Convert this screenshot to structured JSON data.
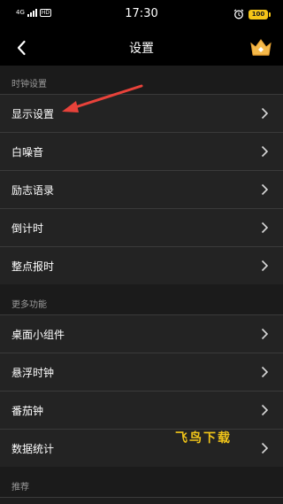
{
  "status_bar": {
    "time": "17:30",
    "network": "4G",
    "hd": "HD",
    "battery": "100"
  },
  "nav": {
    "title": "设置"
  },
  "sections": [
    {
      "header": "时钟设置",
      "items": [
        "显示设置",
        "白噪音",
        "励志语录",
        "倒计时",
        "整点报时"
      ]
    },
    {
      "header": "更多功能",
      "items": [
        "桌面小组件",
        "悬浮时钟",
        "番茄钟",
        "数据统计"
      ]
    },
    {
      "header": "推荐",
      "items": []
    }
  ],
  "watermark": "飞鸟下载",
  "colors": {
    "background": "#1b1b1b",
    "row": "#232323",
    "divider": "#3a3a3a",
    "annotation_arrow": "#e8423a",
    "vip_gold": "#f5b94a",
    "battery": "#f5c518"
  }
}
